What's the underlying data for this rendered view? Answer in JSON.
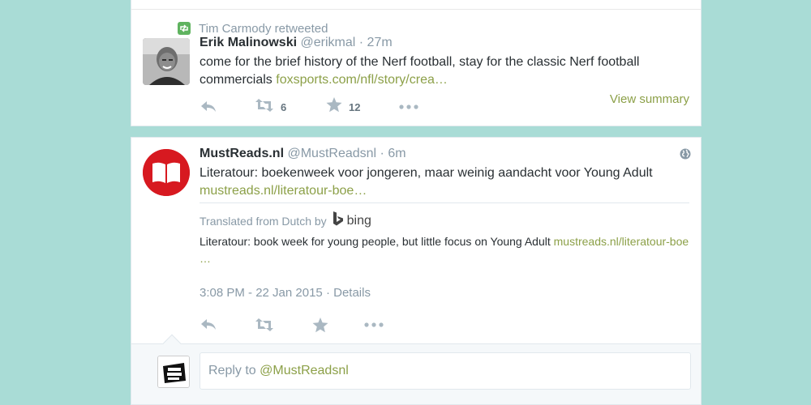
{
  "retweet_tweet": {
    "context_text": "Tim Carmody retweeted",
    "author_name": "Erik Malinowski",
    "author_handle": "@erikmal",
    "time": "27m",
    "text": "come for the brief history of the Nerf football, stay for the classic Nerf football commercials",
    "link": "foxsports.com/nfl/story/crea…",
    "retweet_count": "6",
    "favorite_count": "12",
    "view_summary": "View summary"
  },
  "main_tweet": {
    "author_name": "MustReads.nl",
    "author_handle": "@MustReadsnl",
    "time": "6m",
    "text": "Literatour: boekenweek voor jongeren, maar weinig aandacht voor Young Adult",
    "link": "mustreads.nl/literatour-boe…",
    "translated_label": "Translated from Dutch by",
    "translator": "bing",
    "translation_text": "Literatour: book week for young people, but little focus on Young Adult",
    "translation_link": "mustreads.nl/literatour-boe",
    "translation_ellipsis": "…",
    "timestamp": "3:08 PM - 22 Jan 2015",
    "details": "Details"
  },
  "reply": {
    "prefix": "Reply to",
    "mention": "@MustReadsnl"
  },
  "colors": {
    "background": "#a9dcd6",
    "link": "#8ca048",
    "muted": "#8899a6",
    "retweet_badge": "#5fb35f",
    "mustreads_brand": "#d71920"
  },
  "icons": [
    "retweet-icon",
    "reply-icon",
    "favorite-icon",
    "more-icon",
    "globe-icon",
    "bing-icon",
    "book-icon"
  ]
}
